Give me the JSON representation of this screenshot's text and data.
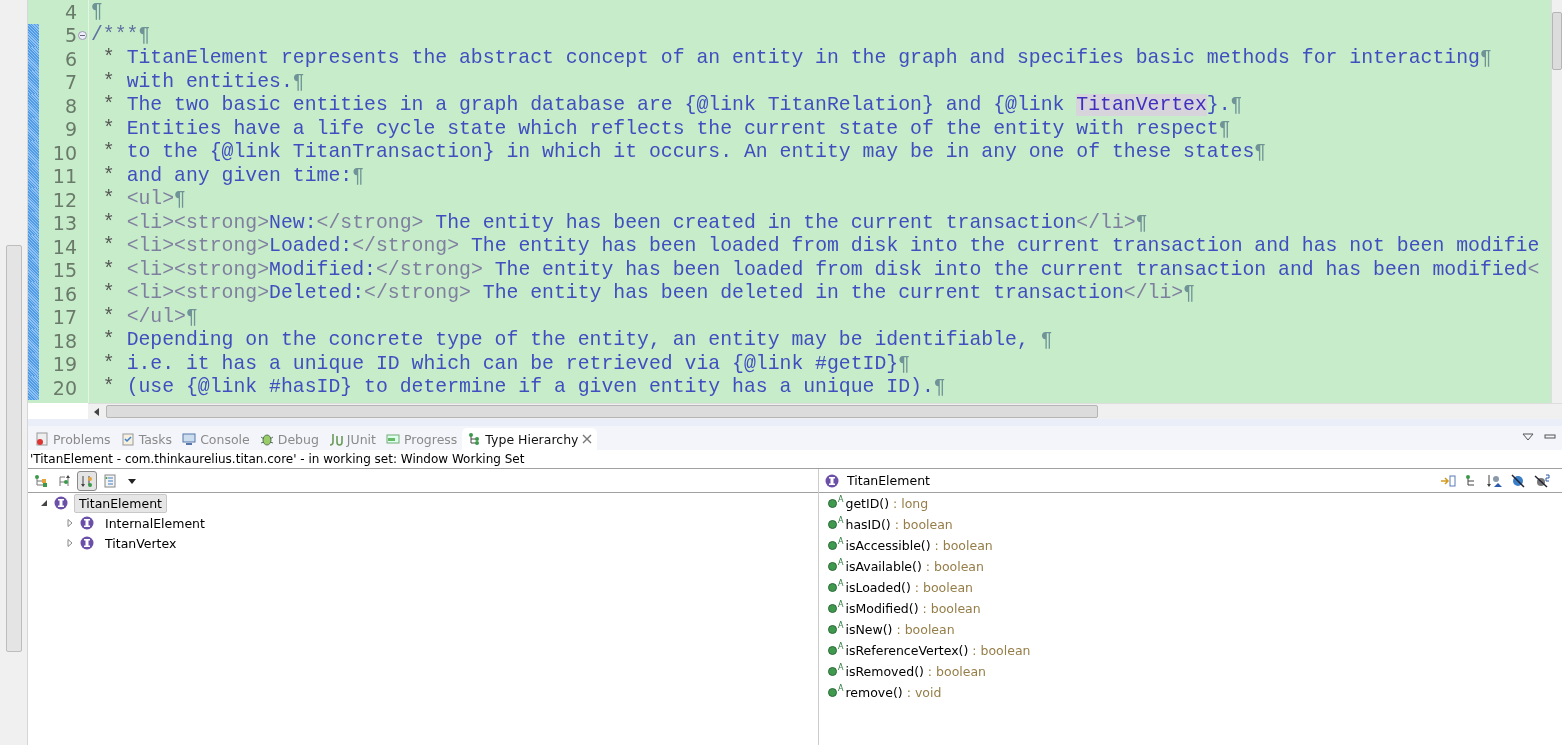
{
  "editor": {
    "lines": [
      {
        "number": "4",
        "changed": false,
        "collapsible": false,
        "end_mark": "¶"
      },
      {
        "number": "5",
        "changed": true,
        "collapsible": true,
        "parts": [
          {
            "kind": "delim",
            "text": "/***"
          }
        ],
        "end_mark": "¶"
      },
      {
        "number": "6",
        "changed": true,
        "collapsible": false,
        "parts": [
          {
            "kind": "star",
            "text": " * "
          },
          {
            "kind": "doc",
            "text": "TitanElement represents the abstract concept of an entity in the graph and specifies basic methods for interacting"
          }
        ],
        "end_mark": "¶"
      },
      {
        "number": "7",
        "changed": true,
        "collapsible": false,
        "parts": [
          {
            "kind": "star",
            "text": " * "
          },
          {
            "kind": "doc",
            "text": "with entities."
          }
        ],
        "end_mark": "¶"
      },
      {
        "number": "8",
        "changed": true,
        "collapsible": false,
        "parts": [
          {
            "kind": "star",
            "text": " * "
          },
          {
            "kind": "doc",
            "text": "The two basic entities in a graph database are {@link TitanRelation} and {@link "
          },
          {
            "kind": "highlight",
            "text": "TitanVertex"
          },
          {
            "kind": "doc",
            "text": "}."
          }
        ],
        "end_mark": "¶"
      },
      {
        "number": "9",
        "changed": true,
        "collapsible": false,
        "parts": [
          {
            "kind": "star",
            "text": " * "
          },
          {
            "kind": "doc",
            "text": "Entities have a life cycle state which reflects the current state of the entity with respect"
          }
        ],
        "end_mark": "¶"
      },
      {
        "number": "10",
        "changed": true,
        "collapsible": false,
        "parts": [
          {
            "kind": "star",
            "text": " * "
          },
          {
            "kind": "doc",
            "text": "to the {@link TitanTransaction} in which it occurs. An entity may be in any one of these states"
          }
        ],
        "end_mark": "¶"
      },
      {
        "number": "11",
        "changed": true,
        "collapsible": false,
        "parts": [
          {
            "kind": "star",
            "text": " * "
          },
          {
            "kind": "doc",
            "text": "and any given time:"
          }
        ],
        "end_mark": "¶"
      },
      {
        "number": "12",
        "changed": true,
        "collapsible": false,
        "parts": [
          {
            "kind": "star",
            "text": " * "
          },
          {
            "kind": "tag",
            "text": "<ul>"
          }
        ],
        "end_mark": "¶"
      },
      {
        "number": "13",
        "changed": true,
        "collapsible": false,
        "parts": [
          {
            "kind": "star",
            "text": " * "
          },
          {
            "kind": "tag",
            "text": "<li><strong>"
          },
          {
            "kind": "doc",
            "text": "New:"
          },
          {
            "kind": "tag",
            "text": "</strong>"
          },
          {
            "kind": "doc",
            "text": " The entity has been created in the current transaction"
          },
          {
            "kind": "tag",
            "text": "</li>"
          }
        ],
        "end_mark": "¶"
      },
      {
        "number": "14",
        "changed": true,
        "collapsible": false,
        "parts": [
          {
            "kind": "star",
            "text": " * "
          },
          {
            "kind": "tag",
            "text": "<li><strong>"
          },
          {
            "kind": "doc",
            "text": "Loaded:"
          },
          {
            "kind": "tag",
            "text": "</strong>"
          },
          {
            "kind": "doc",
            "text": " The entity has been loaded from disk into the current transaction and has not been modifie"
          }
        ]
      },
      {
        "number": "15",
        "changed": true,
        "collapsible": false,
        "parts": [
          {
            "kind": "star",
            "text": " * "
          },
          {
            "kind": "tag",
            "text": "<li><strong>"
          },
          {
            "kind": "doc",
            "text": "Modified:"
          },
          {
            "kind": "tag",
            "text": "</strong>"
          },
          {
            "kind": "doc",
            "text": " The entity has been loaded from disk into the current transaction and has been modified"
          },
          {
            "kind": "tag",
            "text": "<"
          }
        ]
      },
      {
        "number": "16",
        "changed": true,
        "collapsible": false,
        "parts": [
          {
            "kind": "star",
            "text": " * "
          },
          {
            "kind": "tag",
            "text": "<li><strong>"
          },
          {
            "kind": "doc",
            "text": "Deleted:"
          },
          {
            "kind": "tag",
            "text": "</strong>"
          },
          {
            "kind": "doc",
            "text": " The entity has been deleted in the current transaction"
          },
          {
            "kind": "tag",
            "text": "</li>"
          }
        ],
        "end_mark": "¶"
      },
      {
        "number": "17",
        "changed": true,
        "collapsible": false,
        "parts": [
          {
            "kind": "star",
            "text": " * "
          },
          {
            "kind": "tag",
            "text": "</ul>"
          }
        ],
        "end_mark": "¶"
      },
      {
        "number": "18",
        "changed": true,
        "collapsible": false,
        "parts": [
          {
            "kind": "star",
            "text": " * "
          },
          {
            "kind": "doc",
            "text": "Depending on the concrete type of the entity, an entity may be identifiable, "
          }
        ],
        "end_mark": "¶"
      },
      {
        "number": "19",
        "changed": true,
        "collapsible": false,
        "parts": [
          {
            "kind": "star",
            "text": " * "
          },
          {
            "kind": "doc",
            "text": "i.e. it has a unique ID which can be retrieved via {@link #getID}"
          }
        ],
        "end_mark": "¶"
      },
      {
        "number": "20",
        "changed": true,
        "collapsible": false,
        "parts": [
          {
            "kind": "star",
            "text": " * "
          },
          {
            "kind": "doc",
            "text": "(use {@link #hasID} to determine if a given entity has a unique ID)."
          }
        ],
        "end_mark": "¶"
      }
    ]
  },
  "panel": {
    "tabs": [
      {
        "label": "Problems",
        "selected": false
      },
      {
        "label": "Tasks",
        "selected": false
      },
      {
        "label": "Console",
        "selected": false
      },
      {
        "label": "Debug",
        "selected": false
      },
      {
        "label": "JUnit",
        "selected": false
      },
      {
        "label": "Progress",
        "selected": false
      },
      {
        "label": "Type Hierarchy",
        "selected": true
      }
    ],
    "info": "'TitanElement - com.thinkaurelius.titan.core' - in working set: Window Working Set",
    "toolbar_buttons": [
      {
        "selected": false
      },
      {
        "selected": false
      },
      {
        "selected": true
      },
      {
        "selected": false
      }
    ],
    "tree": [
      {
        "label": "TitanElement",
        "selected": true,
        "expanded": true,
        "children": [
          {
            "label": "InternalElement",
            "selected": false,
            "expanded": false
          },
          {
            "label": "TitanVertex",
            "selected": false,
            "expanded": false
          }
        ]
      }
    ],
    "members": {
      "title": "TitanElement",
      "items": [
        {
          "name": "getID()",
          "modifier": "A",
          "type": ": long"
        },
        {
          "name": "hasID()",
          "modifier": "A",
          "type": ": boolean"
        },
        {
          "name": "isAccessible()",
          "modifier": "A",
          "type": ": boolean"
        },
        {
          "name": "isAvailable()",
          "modifier": "A",
          "type": ": boolean"
        },
        {
          "name": "isLoaded()",
          "modifier": "A",
          "type": ": boolean"
        },
        {
          "name": "isModified()",
          "modifier": "A",
          "type": ": boolean"
        },
        {
          "name": "isNew()",
          "modifier": "A",
          "type": ": boolean"
        },
        {
          "name": "isReferenceVertex()",
          "modifier": "A",
          "type": ": boolean"
        },
        {
          "name": "isRemoved()",
          "modifier": "A",
          "type": ": boolean"
        },
        {
          "name": "remove()",
          "modifier": "A",
          "type": ": void"
        }
      ]
    }
  }
}
